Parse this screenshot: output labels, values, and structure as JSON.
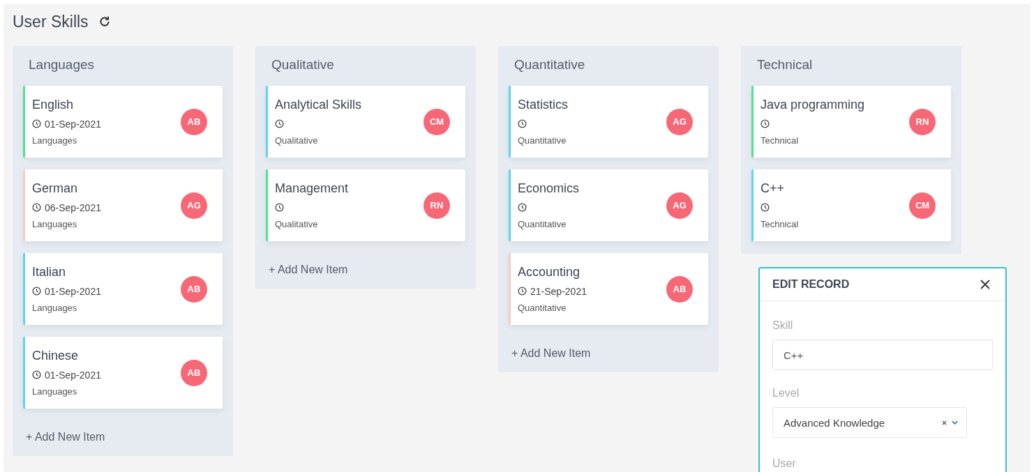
{
  "page": {
    "title": "User Skills"
  },
  "columns": [
    {
      "title": "Languages",
      "add_item": "+ Add New Item",
      "cards": [
        {
          "title": "English",
          "date": "01-Sep-2021",
          "category": "Languages",
          "avatar": "AB",
          "color": "#4ee28f"
        },
        {
          "title": "German",
          "date": "06-Sep-2021",
          "category": "Languages",
          "avatar": "AG",
          "color": "#f9cdbb"
        },
        {
          "title": "Italian",
          "date": "01-Sep-2021",
          "category": "Languages",
          "avatar": "AB",
          "color": "#5ad3f5"
        },
        {
          "title": "Chinese",
          "date": "01-Sep-2021",
          "category": "Languages",
          "avatar": "AB",
          "color": "#5ad3f5"
        }
      ]
    },
    {
      "title": "Qualitative",
      "add_item": "+ Add New Item",
      "cards": [
        {
          "title": "Analytical Skills",
          "category": "Qualitative",
          "avatar": "CM",
          "color": "#5ad3f5"
        },
        {
          "title": "Management",
          "category": "Qualitative",
          "avatar": "RN",
          "color": "#4ee28f"
        }
      ]
    },
    {
      "title": "Quantitative",
      "add_item": "+ Add New Item",
      "cards": [
        {
          "title": "Statistics",
          "category": "Quantitative",
          "avatar": "AG",
          "color": "#5ad3f5"
        },
        {
          "title": "Economics",
          "category": "Quantitative",
          "avatar": "AG",
          "color": "#5ad3f5"
        },
        {
          "title": "Accounting",
          "date": "21-Sep-2021",
          "category": "Quantitative",
          "avatar": "AB",
          "color": "#f9cdbb"
        }
      ]
    },
    {
      "title": "Technical",
      "cards": [
        {
          "title": "Java programming",
          "category": "Technical",
          "avatar": "RN",
          "color": "#4ee28f"
        },
        {
          "title": "C++",
          "category": "Technical",
          "avatar": "CM",
          "color": "#5ad3f5"
        }
      ]
    }
  ],
  "dialog": {
    "title": "EDIT RECORD",
    "fields": [
      {
        "kind": "text",
        "label": "Skill",
        "value": "C++"
      },
      {
        "kind": "select",
        "label": "Level",
        "value": "Advanced Knowledge"
      },
      {
        "kind": "label",
        "label": "User"
      }
    ]
  }
}
